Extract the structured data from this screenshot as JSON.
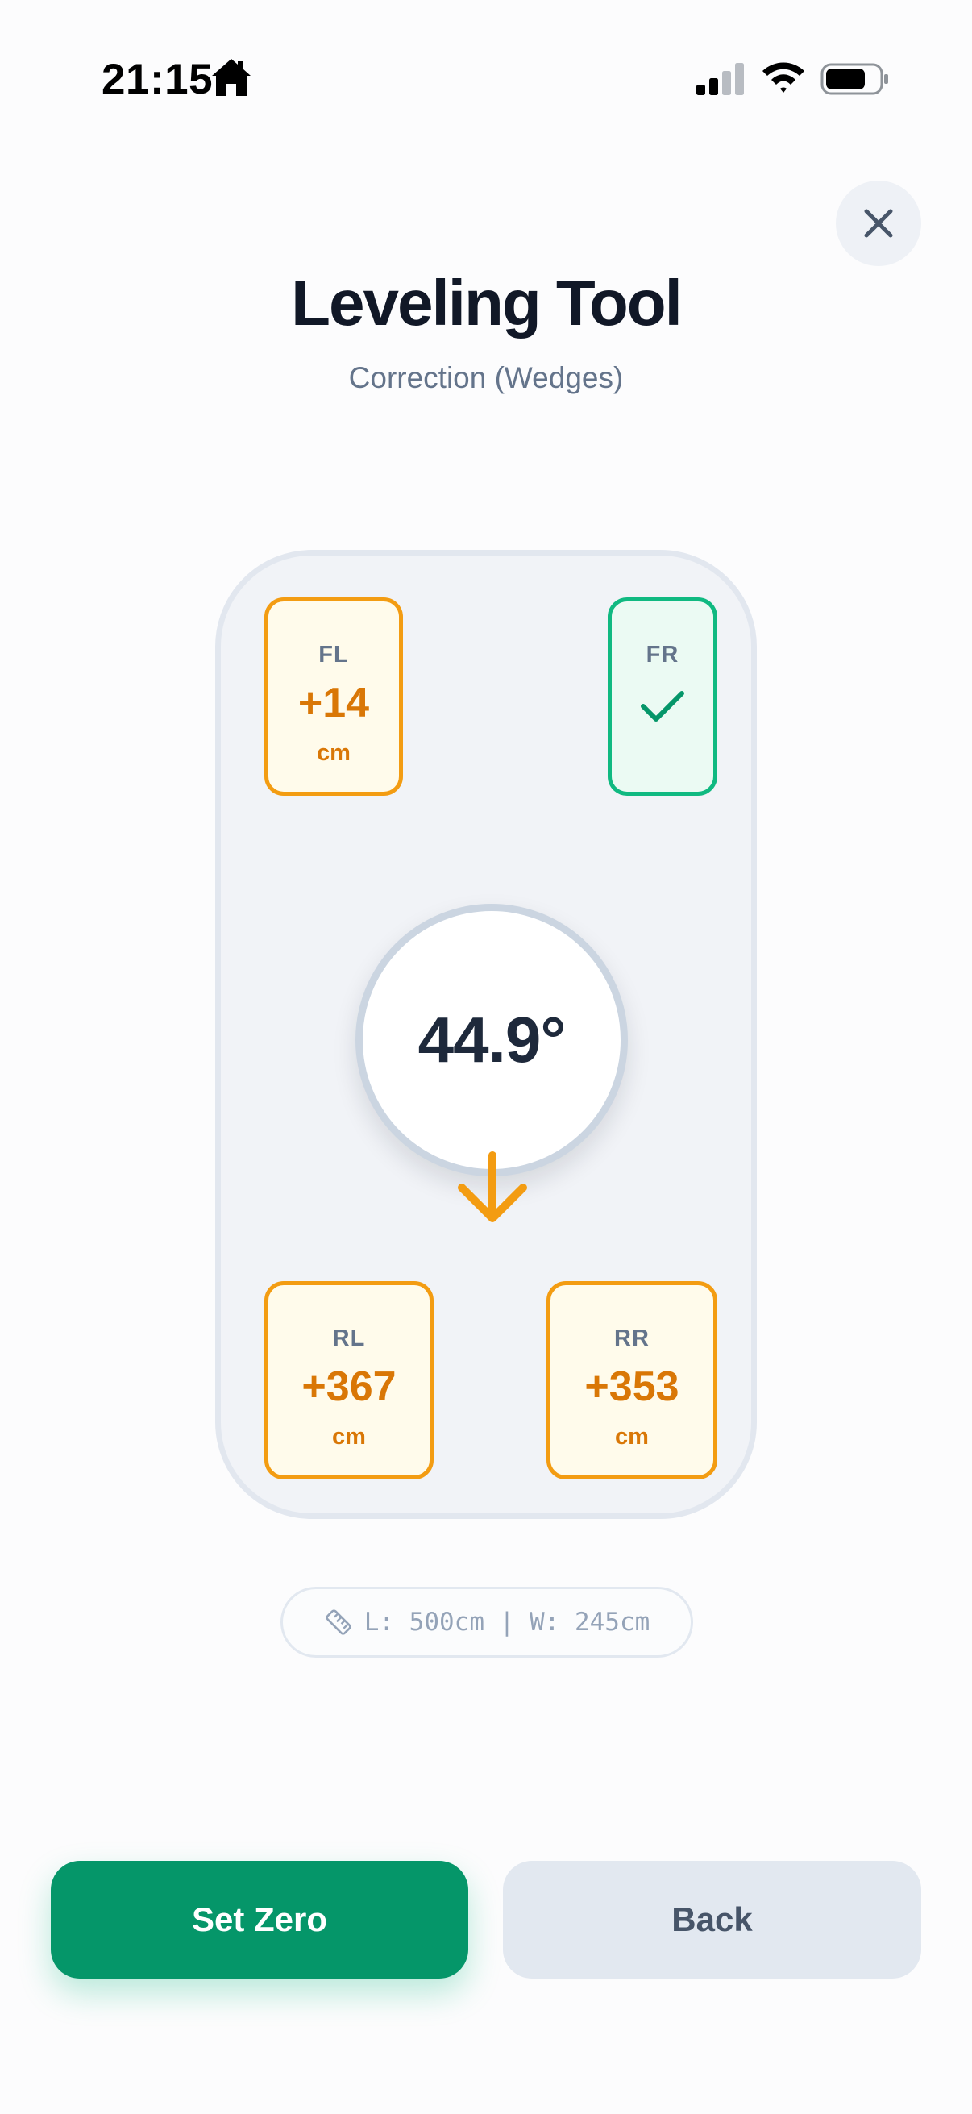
{
  "status_bar": {
    "time": "21:15"
  },
  "header": {
    "title": "Leveling Tool",
    "subtitle": "Correction (Wedges)"
  },
  "vehicle": {
    "wheels": {
      "fl": {
        "label": "FL",
        "value": "+14",
        "unit": "cm",
        "status": "adjust"
      },
      "fr": {
        "label": "FR",
        "status": "ok"
      },
      "rl": {
        "label": "RL",
        "value": "+367",
        "unit": "cm",
        "status": "adjust"
      },
      "rr": {
        "label": "RR",
        "value": "+353",
        "unit": "cm",
        "status": "adjust"
      }
    },
    "angle": "44.9°",
    "tilt_direction": "down"
  },
  "dimensions": {
    "text": "L: 500cm | W: 245cm",
    "icon": "ruler-icon"
  },
  "actions": {
    "primary_label": "Set Zero",
    "secondary_label": "Back"
  },
  "colors": {
    "primary": "#059669",
    "warning": "#f39c12",
    "warning_text": "#d97706",
    "ok": "#10b981"
  }
}
